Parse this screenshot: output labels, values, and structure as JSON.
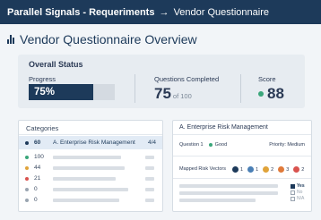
{
  "topbar": {
    "title": "Parallel Signals - Requeriments",
    "arrow": "→",
    "subtitle": "Vendor Questionnaire"
  },
  "page": {
    "title": "Vendor Questionnaire Overview"
  },
  "overall_status": {
    "heading": "Overall Status",
    "progress_label": "Progress",
    "progress_value": "75%",
    "progress_fraction": 0.75,
    "questions_label": "Questions Completed",
    "questions_completed": "75",
    "questions_total": "of 100",
    "score_label": "Score",
    "score_value": "88",
    "score_color": "#3aa67a"
  },
  "categories": {
    "heading": "Categories",
    "selected": {
      "score": "60",
      "name": "A. Enterprise Risk Management",
      "count": "4/4",
      "dot_color": "#1d3a5a"
    },
    "rows": [
      {
        "score": "100",
        "dot_color": "#3aa67a"
      },
      {
        "score": "44",
        "dot_color": "#e0a33a"
      },
      {
        "score": "21",
        "dot_color": "#d9534f"
      },
      {
        "score": "0",
        "dot_color": "#9aa5b1"
      },
      {
        "score": "0",
        "dot_color": "#9aa5b1"
      }
    ]
  },
  "section": {
    "heading": "A. Enterprise Risk Management",
    "question_label": "Question 1",
    "question_status": "Good",
    "question_status_color": "#3aa67a",
    "priority": "Priority: Medium",
    "vectors_label": "Mapped Risk Vectors",
    "vectors": [
      {
        "count": "1",
        "color": "#1d3a5a"
      },
      {
        "count": "1",
        "color": "#4a7fb5"
      },
      {
        "count": "2",
        "color": "#e0a33a"
      },
      {
        "count": "3",
        "color": "#e07a3a"
      },
      {
        "count": "2",
        "color": "#d9534f"
      }
    ],
    "answers": [
      {
        "label": "Yes",
        "checked": true
      },
      {
        "label": "No",
        "checked": false
      },
      {
        "label": "N/A",
        "checked": false
      }
    ]
  }
}
